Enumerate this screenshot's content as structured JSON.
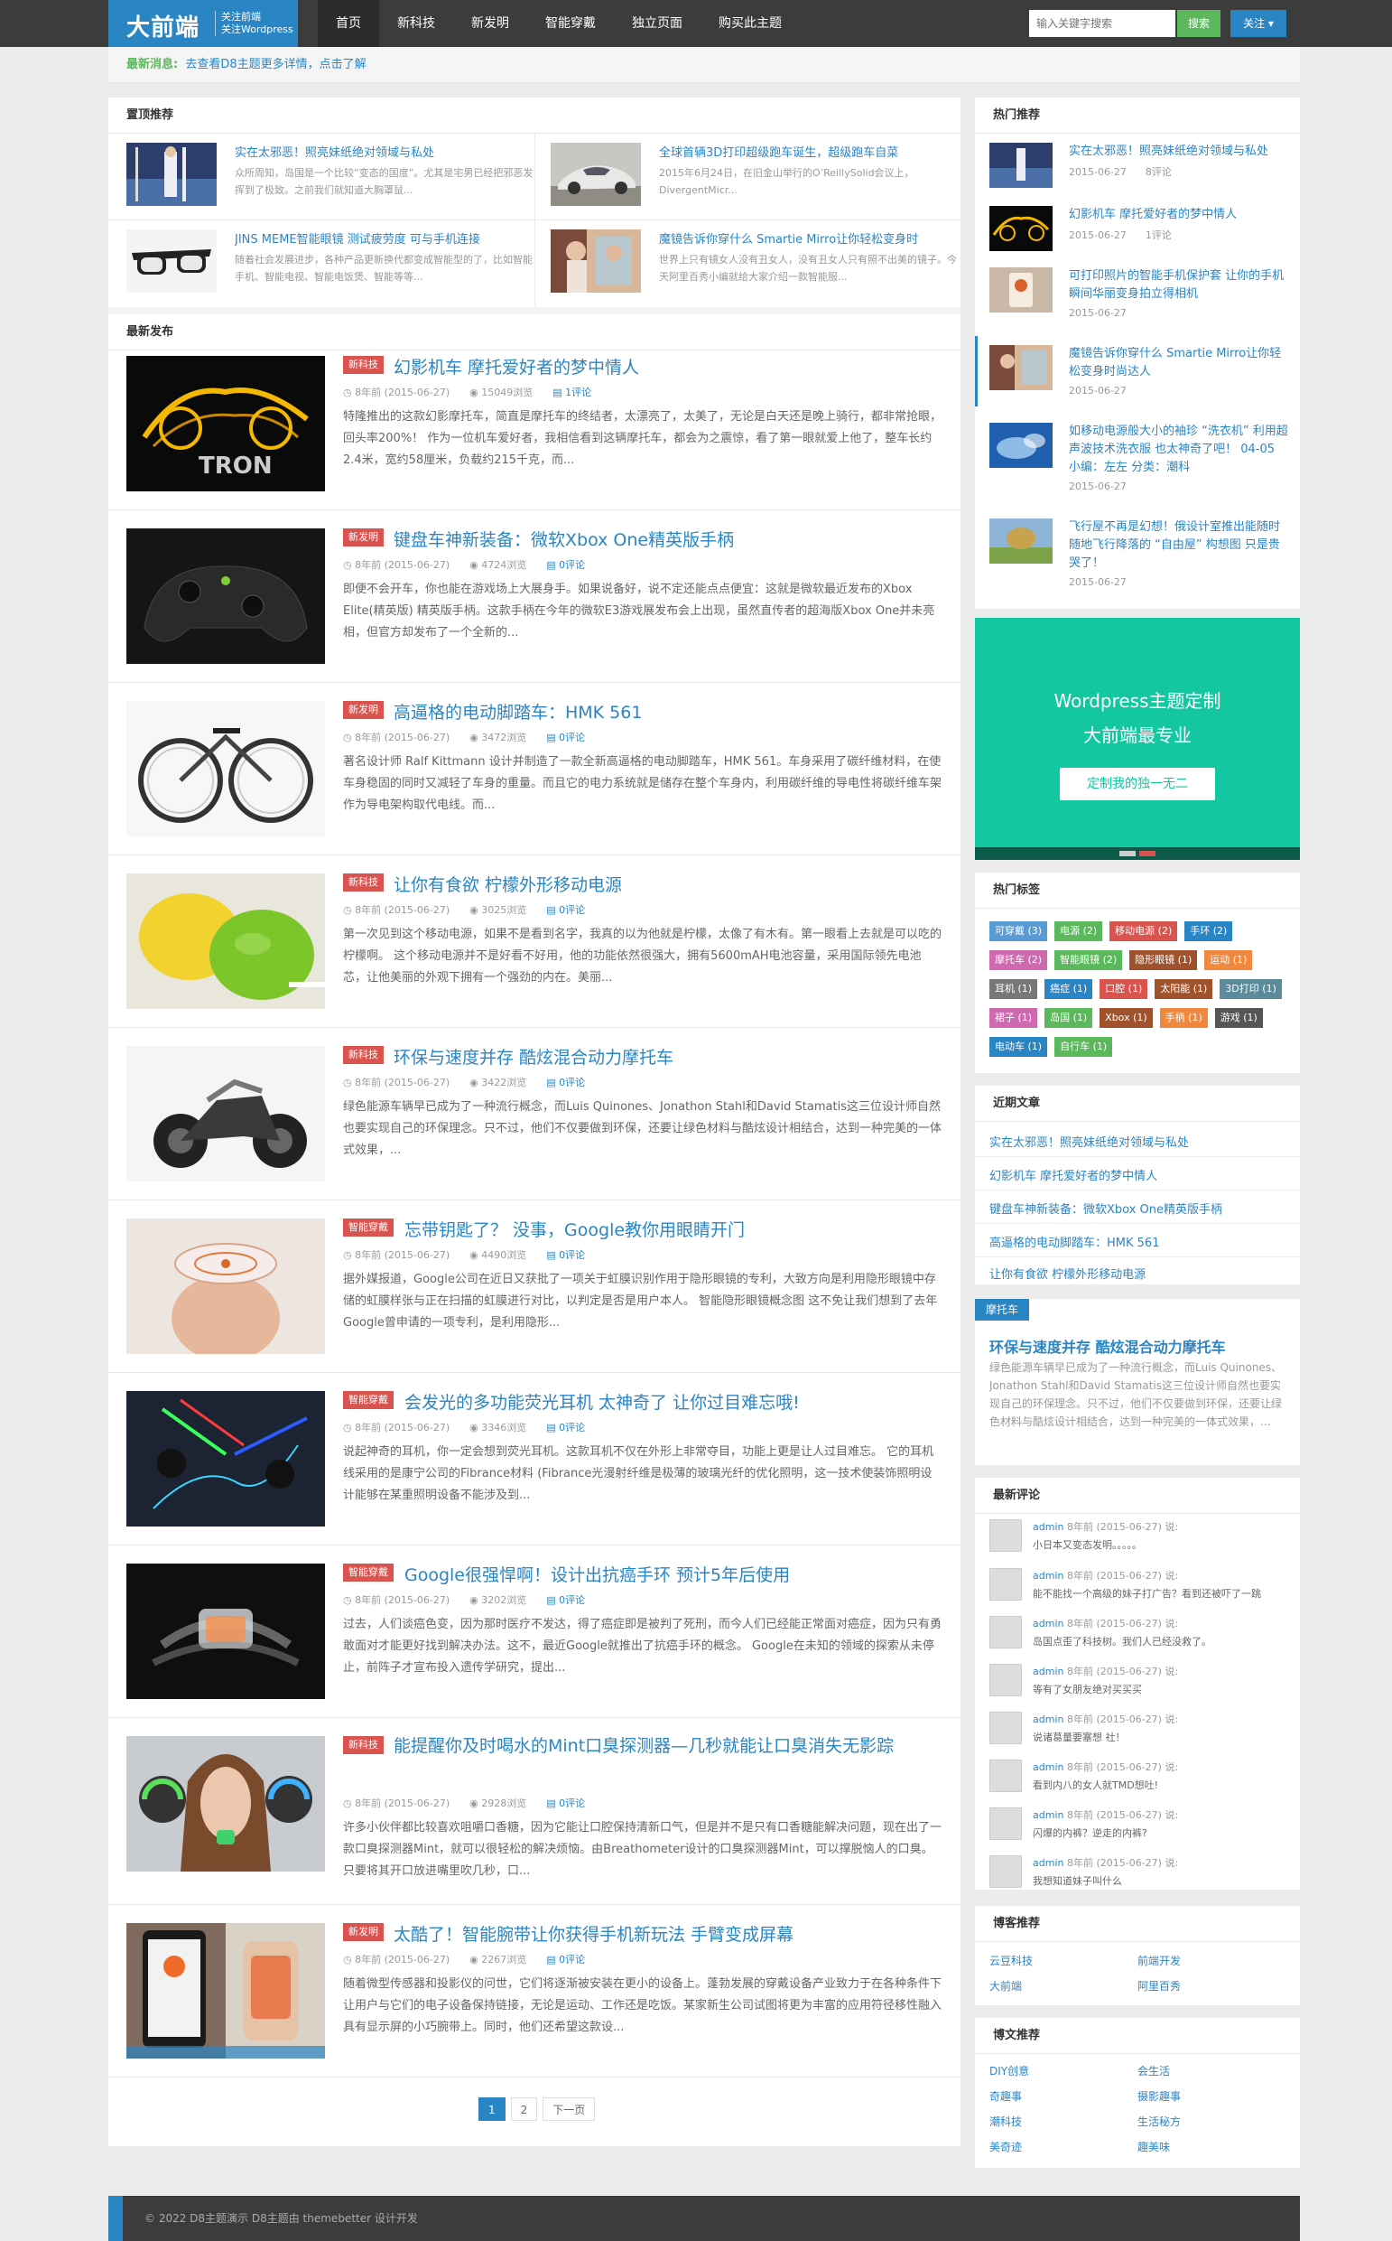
{
  "site": {
    "logo_main": "大前端",
    "logo_sub1": "关注前端",
    "logo_sub2": "关注Wordpress",
    "nav": [
      "首页",
      "新科技",
      "新发明",
      "智能穿戴",
      "独立页面",
      "购买此主题"
    ],
    "search_placeholder": "输入关键字搜索",
    "search_label": "搜索",
    "follow_label": "关注"
  },
  "notice": {
    "label": "最新消息:",
    "text": "去查看D8主题更多详情，点击了解"
  },
  "sticky": {
    "title": "置顶推荐",
    "items": [
      {
        "title": "实在太邪恶！照亮妹纸绝对领域与私处",
        "desc": "众所周知，岛国是一个比较“变态的国度”。尤其是宅男已经把邪恶发挥到了极致。之前我们就知道大胸罩鼠..."
      },
      {
        "title": "全球首辆3D打印超级跑车诞生，超级跑车自菜",
        "desc": "2015年6月24日，在旧金山举行的O’ReillySolid会议上，DivergentMicr..."
      },
      {
        "title": "JINS MEME智能眼镜 测试疲劳度 可与手机连接",
        "desc": "随着社会发展进步，各种产品更新换代都变成智能型的了，比如智能手机、智能电视、智能电饭煲、智能等等..."
      },
      {
        "title": "魔镜告诉你穿什么 Smartie Mirro让你轻松变身时",
        "desc": "世界上只有镜女人没有丑女人，没有丑女人只有照不出美的镜子。今天阿里百秀小编就给大家介绍一款智能服..."
      }
    ]
  },
  "latest": {
    "title": "最新发布",
    "posts": [
      {
        "cat": "新科技",
        "title": "幻影机车 摩托爱好者的梦中情人",
        "time": "8年前 (2015-06-27)",
        "views": "15049浏览",
        "comments": "1评论",
        "excerpt": "特隆推出的这款幻影摩托车，简直是摩托车的终结者，太漂亮了，太美了，无论是白天还是晚上骑行，都非常抢眼，回头率200%！ 作为一位机车爱好者，我相信看到这辆摩托车，都会为之震惊，看了第一眼就爱上他了，整车长约2.4米，宽约58厘米，负载约215千克，而..."
      },
      {
        "cat": "新发明",
        "title": "键盘车神新装备：微软Xbox One精英版手柄",
        "time": "8年前 (2015-06-27)",
        "views": "4724浏览",
        "comments": "0评论",
        "excerpt": "即便不会开车，你也能在游戏场上大展身手。如果说备好，说不定还能点点便宜：这就是微软最近发布的Xbox Elite(精英版) 精英版手柄。这款手柄在今年的微软E3游戏展发布会上出现，虽然直传者的超海版Xbox One并未亮相，但官方却发布了一个全新的..."
      },
      {
        "cat": "新发明",
        "title": "高逼格的电动脚踏车：HMK 561",
        "time": "8年前 (2015-06-27)",
        "views": "3472浏览",
        "comments": "0评论",
        "excerpt": "著名设计师 Ralf Kittmann 设计并制造了一款全新高逼格的电动脚踏车，HMK 561。车身采用了碳纤维材料，在使车身稳固的同时又减轻了车身的重量。而且它的电力系统就是储存在整个车身内，利用碳纤维的导电性将碳纤维车架作为导电架构取代电线。而..."
      },
      {
        "cat": "新科技",
        "title": "让你有食欲 柠檬外形移动电源",
        "time": "8年前 (2015-06-27)",
        "views": "3025浏览",
        "comments": "0评论",
        "excerpt": "第一次见到这个移动电源，如果不是看到名字，我真的以为他就是柠檬，太像了有木有。第一眼看上去就是可以吃的柠檬啊。 这个移动电源并不是好看不好用，他的功能依然很强大，拥有5600mAH电池容量，采用国际领先电池芯，让他美丽的外观下拥有一个强劲的内在。美丽..."
      },
      {
        "cat": "新科技",
        "title": "环保与速度并存 酷炫混合动力摩托车",
        "time": "8年前 (2015-06-27)",
        "views": "3422浏览",
        "comments": "0评论",
        "excerpt": "绿色能源车辆早已成为了一种流行概念，而Luis Quinones、Jonathon Stahl和David Stamatis这三位设计师自然也要实现自己的环保理念。只不过，他们不仅要做到环保，还要让绿色材料与酷炫设计相结合，达到一种完美的一体式效果，..."
      },
      {
        "cat": "智能穿戴",
        "title": "忘带钥匙了？ 没事，Google教你用眼睛开门",
        "time": "8年前 (2015-06-27)",
        "views": "4490浏览",
        "comments": "0评论",
        "excerpt": "据外媒报道，Google公司在近日又获批了一项关于虹膜识别作用于隐形眼镜的专利，大致方向是利用隐形眼镜中存储的虹膜样张与正在扫描的虹膜进行对比，以判定是否是用户本人。 智能隐形眼镜概念图 这不免让我们想到了去年Google曾申请的一项专利，是利用隐形..."
      },
      {
        "cat": "智能穿戴",
        "title": "会发光的多功能荧光耳机 太神奇了 让你过目难忘哦!",
        "time": "8年前 (2015-06-27)",
        "views": "3346浏览",
        "comments": "0评论",
        "excerpt": "说起神奇的耳机，你一定会想到荧光耳机。这款耳机不仅在外形上非常夺目，功能上更是让人过目难忘。 它的耳机线采用的是康宁公司的Fibrance材料 (Fibrance光漫射纤维是极薄的玻璃光纤的优化照明，这一技术使装饰照明设计能够在某重照明设备不能涉及到..."
      },
      {
        "cat": "智能穿戴",
        "title": "Google很强悍啊！设计出抗癌手环 预计5年后使用",
        "time": "8年前 (2015-06-27)",
        "views": "3202浏览",
        "comments": "0评论",
        "excerpt": "过去，人们谈癌色变，因为那时医疗不发达，得了癌症即是被判了死刑，而今人们已经能正常面对癌症，因为只有勇敢面对才能更好找到解决办法。这不，最近Google就推出了抗癌手环的概念。 Google在未知的领域的探索从未停止，前阵子才宣布投入遗传学研究，提出..."
      },
      {
        "cat": "新科技",
        "title": "能提醒你及时喝水的Mint口臭探测器—几秒就能让口臭消失无影踪",
        "time": "8年前 (2015-06-27)",
        "views": "2928浏览",
        "comments": "0评论",
        "excerpt": "许多小伙伴都比较喜欢咀嚼口香糖，因为它能让口腔保持清新口气，但是并不是只有口香糖能解决问题，现在出了一款口臭探测器Mint，就可以很轻松的解决烦恼。由Breathometer设计的口臭探测器Mint，可以撑脱恼人的口臭。只要将其开口放进嘴里吹几秒，口..."
      },
      {
        "cat": "新发明",
        "title": "太酷了！智能腕带让你获得手机新玩法 手臂变成屏幕",
        "time": "8年前 (2015-06-27)",
        "views": "2267浏览",
        "comments": "0评论",
        "excerpt": "随着微型传感器和投影仪的问世，它们将逐渐被安装在更小的设备上。蓬勃发展的穿戴设备产业致力于在各种条件下让用户与它们的电子设备保持链接，无论是运动、工作还是吃饭。某家新生公司试图将更为丰富的应用符径移性融入具有显示屏的小巧腕带上。同时，他们还希望这款设..."
      }
    ],
    "pager": [
      "1",
      "2",
      "下一页"
    ]
  },
  "sidebar": {
    "hot_title": "热门推荐",
    "hot": [
      {
        "title": "实在太邪恶！照亮妹纸绝对领域与私处",
        "date": "2015-06-27",
        "comments": "8评论"
      },
      {
        "title": "幻影机车 摩托爱好者的梦中情人",
        "date": "2015-06-27",
        "comments": "1评论"
      },
      {
        "title": "可打印照片的智能手机保护套 让你的手机瞬间华丽变身拍立得相机",
        "date": "2015-06-27",
        "comments": ""
      },
      {
        "title": "魔镜告诉你穿什么 Smartie Mirro让你轻松变身时尚达人",
        "date": "2015-06-27",
        "comments": ""
      },
      {
        "title": "如移动电源般大小的袖珍 “洗衣机” 利用超声波技术洗衣服 也太神奇了吧！ 04-05 小编：左左 分类：潮科",
        "date": "2015-06-27",
        "comments": ""
      },
      {
        "title": "飞行屋不再是幻想！俄设计室推出能随时随地飞行降落的 “自由屋” 构想图 只是贵哭了！",
        "date": "2015-06-27",
        "comments": ""
      }
    ],
    "ad": {
      "line1": "Wordpress主题定制",
      "line2": "大前端最专业",
      "button": "定制我的独一无二"
    },
    "tags_title": "热门标签",
    "tags": [
      "可穿戴 (3)",
      "电源 (2)",
      "移动电源 (2)",
      "手环 (2)",
      "摩托车 (2)",
      "智能眼镜 (2)",
      "隐形眼镜 (1)",
      "运动 (1)",
      "耳机 (1)",
      "癌症 (1)",
      "口腔 (1)",
      "太阳能 (1)",
      "3D打印 (1)",
      "裙子 (1)",
      "岛国 (1)",
      "Xbox (1)",
      "手柄 (1)",
      "游戏 (1)",
      "电动车 (1)",
      "自行车 (1)"
    ],
    "tag_colors": [
      "#5b9bd5",
      "#5cb85c",
      "#d9534f",
      "#2a85c5",
      "#d06ab0",
      "#5cb85c",
      "#a0522d",
      "#f0883e",
      "#777777",
      "#2a85c5",
      "#d9534f",
      "#a0522d",
      "#5b8a9b",
      "#d06ab0",
      "#5cb85c",
      "#a0522d",
      "#f0883e",
      "#555555",
      "#2a85c5",
      "#5cb85c"
    ],
    "recent_title": "近期文章",
    "recent": [
      "实在太邪恶！照亮妹纸绝对领域与私处",
      "幻影机车 摩托爱好者的梦中情人",
      "键盘车神新装备：微软Xbox One精英版手柄",
      "高逼格的电动脚踏车：HMK 561",
      "让你有食欲 柠檬外形移动电源"
    ],
    "featured": {
      "cat": "摩托车",
      "title": "环保与速度并存 酷炫混合动力摩托车",
      "desc": "绿色能源车辆早已成为了一种流行概念，而Luis Quinones、Jonathon Stahl和David Stamatis这三位设计师自然也要实现自己的环保理念。只不过，他们不仅要做到环保，还要让绿色材料与酷炫设计相结合，达到一种完美的一体式效果，..."
    },
    "comments_title": "最新评论",
    "comments": [
      {
        "author": "admin",
        "time": "8年前 (2015-06-27) 说:",
        "text": "小日本又变态发明。。。。。"
      },
      {
        "author": "admin",
        "time": "8年前 (2015-06-27) 说:",
        "text": "能不能找一个高级的妹子打广告？看到还被吓了一跳"
      },
      {
        "author": "admin",
        "time": "8年前 (2015-06-27) 说:",
        "text": "岛国点歪了科技树。我们人已经没救了。"
      },
      {
        "author": "admin",
        "time": "8年前 (2015-06-27) 说:",
        "text": "等有了女朋友绝对买买买"
      },
      {
        "author": "admin",
        "time": "8年前 (2015-06-27) 说:",
        "text": "说诸葛量要塞想 社！"
      },
      {
        "author": "admin",
        "time": "8年前 (2015-06-27) 说:",
        "text": "看到内八的女人就TMD想吐!"
      },
      {
        "author": "admin",
        "time": "8年前 (2015-06-27) 说:",
        "text": "闪爆的内裤？逆走的内裤?"
      },
      {
        "author": "admin",
        "time": "8年前 (2015-06-27) 说:",
        "text": "我想知道妹子叫什么"
      }
    ],
    "blog_title": "博客推荐",
    "blogs": [
      "云豆科技",
      "前端开发",
      "大前端",
      "阿里百秀"
    ],
    "blog2_title": "博文推荐",
    "blogs2": [
      "DIY创意",
      "会生活",
      "奇趣事",
      "摄影趣事",
      "潮科技",
      "生活秘方",
      "美奇迹",
      "趣美味"
    ]
  },
  "footer": {
    "text": "© 2022 D8主题演示   D8主题由 themebetter 设计开发"
  },
  "colors": {
    "brand": "#2a85c5",
    "topbar": "#3c3c3c",
    "category": "#d9534f",
    "ad": "#13c7a0",
    "search_button": "#5cb85c"
  }
}
